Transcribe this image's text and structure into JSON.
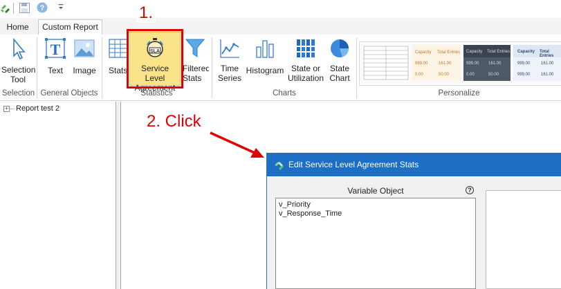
{
  "ribbon": {
    "tabs": [
      {
        "label": "Home",
        "active": false
      },
      {
        "label": "Custom Report",
        "active": true
      }
    ],
    "buttons": {
      "selection_tool": "Selection Tool",
      "text": "Text",
      "image": "Image",
      "stats": "Stats",
      "service_level_agreement": "Service Level Agreement",
      "filtered_stats": "Filtered Stats",
      "time_series": "Time Series",
      "histogram": "Histogram",
      "state_or_utilization": "State or Utilization",
      "state_chart": "State Chart"
    },
    "groups": {
      "selection": "Selection",
      "general_objects": "General Objects",
      "statistics": "Statistics",
      "charts": "Charts",
      "personalize": "Personalize"
    },
    "personalize_styles": {
      "style2": {
        "col1": "Capacity",
        "col2": "Total Entries",
        "r1": [
          "999.00",
          "161.00"
        ],
        "r2": [
          "0.00",
          "50.00"
        ]
      },
      "style3": {
        "col1": "Capacity",
        "col2": "Total Entries",
        "r1": [
          "999.00",
          "161.00"
        ],
        "r2": [
          "0.00",
          "50.00"
        ]
      },
      "style4": {
        "col1": "Capacity",
        "col2": "Total Entries",
        "r1": [
          "999.00",
          "161.00"
        ],
        "r2": [
          "999.00",
          "161.00"
        ]
      }
    }
  },
  "tree": {
    "expander": "+",
    "root_label": "Report test 2"
  },
  "annotations": {
    "step1": "1.",
    "step2": "2. Click",
    "color": "#e00000"
  },
  "dialog": {
    "title": "Edit Service Level Agreement Stats",
    "variable_object_label": "Variable Object",
    "help": "?",
    "variables": [
      "v_Priority",
      "v_Response_Time"
    ]
  },
  "colors": {
    "highlight_fill": "#fbe38a",
    "dialog_title_bar": "#1c6fc5",
    "icon_blue": "#2e7fd1"
  }
}
